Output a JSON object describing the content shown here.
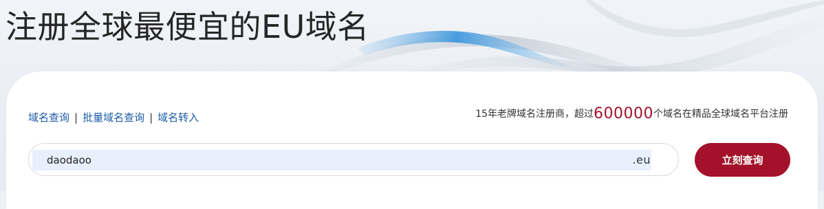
{
  "hero": {
    "title": "注册全球最便宜的EU域名"
  },
  "nav_links": [
    {
      "label": "域名查询"
    },
    {
      "label": "批量域名查询"
    },
    {
      "label": "域名转入"
    }
  ],
  "separator": "|",
  "promo": {
    "prefix": "15年老牌域名注册商，超过",
    "count": "600000",
    "suffix": "个域名在精品全球域名平台注册"
  },
  "search": {
    "value": "daodaoo",
    "tld": ".eu",
    "button_label": "立刻查询"
  },
  "colors": {
    "accent": "#a3122a",
    "link": "#1b5aa6",
    "input_autofill_bg": "#e8f0fe"
  }
}
